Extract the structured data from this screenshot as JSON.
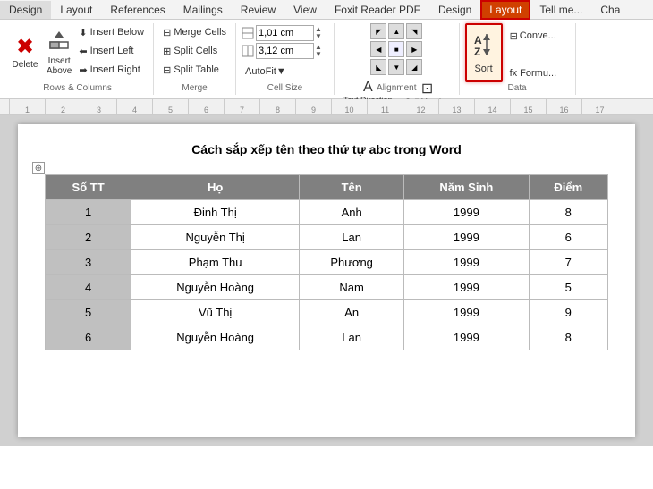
{
  "menubar": {
    "items": [
      {
        "id": "design",
        "label": "Design"
      },
      {
        "id": "layout",
        "label": "Layout"
      },
      {
        "id": "references",
        "label": "References"
      },
      {
        "id": "mailings",
        "label": "Mailings"
      },
      {
        "id": "review",
        "label": "Review"
      },
      {
        "id": "view",
        "label": "View"
      },
      {
        "id": "foxitpdf",
        "label": "Foxit Reader PDF"
      },
      {
        "id": "design2",
        "label": "Design"
      },
      {
        "id": "layout2",
        "label": "Layout"
      },
      {
        "id": "tellme",
        "label": "Tell me..."
      },
      {
        "id": "cha",
        "label": "Cha"
      }
    ]
  },
  "ribbon": {
    "groups": {
      "rows_columns": {
        "label": "Rows & Columns",
        "delete": "Delete",
        "insert_above": "Insert\nAbove",
        "insert_below": "Insert Below",
        "insert_left": "Insert Left",
        "insert_right": "Insert Right"
      },
      "merge": {
        "label": "Merge",
        "merge_cells": "Merge Cells",
        "split_cells": "Split Cells",
        "split_table": "Split Table"
      },
      "cell_size": {
        "label": "Cell Size",
        "height_value": "1,01 cm",
        "width_value": "3,12 cm",
        "autofit": "AutoFit"
      },
      "alignment": {
        "label": "Alignment",
        "text_direction": "Text\nDirection",
        "cell_margins": "Cell\nMargins"
      },
      "data": {
        "label": "Data",
        "sort": "Sort",
        "convert": "Conve...",
        "formula": "fx Formu..."
      }
    }
  },
  "document": {
    "title": "Cách sắp xếp tên theo thứ tự abc trong Word",
    "table": {
      "headers": [
        "Số TT",
        "Họ",
        "Tên",
        "Năm Sinh",
        "Điểm"
      ],
      "rows": [
        {
          "stt": "1",
          "ho": "Đinh Thị",
          "ten": "Anh",
          "nam_sinh": "1999",
          "diem": "8"
        },
        {
          "stt": "2",
          "ho": "Nguyễn Thị",
          "ten": "Lan",
          "nam_sinh": "1999",
          "diem": "6"
        },
        {
          "stt": "3",
          "ho": "Phạm Thu",
          "ten": "Phương",
          "nam_sinh": "1999",
          "diem": "7"
        },
        {
          "stt": "4",
          "ho": "Nguyễn Hoàng",
          "ten": "Nam",
          "nam_sinh": "1999",
          "diem": "5"
        },
        {
          "stt": "5",
          "ho": "Vũ Thị",
          "ten": "An",
          "nam_sinh": "1999",
          "diem": "9"
        },
        {
          "stt": "6",
          "ho": "Nguyễn Hoàng",
          "ten": "Lan",
          "nam_sinh": "1999",
          "diem": "8"
        }
      ]
    }
  },
  "ruler": {
    "marks": [
      "1",
      "2",
      "3",
      "4",
      "5",
      "6",
      "7",
      "8",
      "9",
      "10",
      "11",
      "12",
      "13",
      "14",
      "15",
      "16",
      "17"
    ]
  },
  "icons": {
    "delete": "✖",
    "insert_above": "⬆",
    "table_icon": "⊞",
    "arrow_up": "▲",
    "arrow_down": "▼",
    "merge": "⊟",
    "split": "⊞",
    "sort_az": "AZ↓",
    "move": "⊕"
  }
}
